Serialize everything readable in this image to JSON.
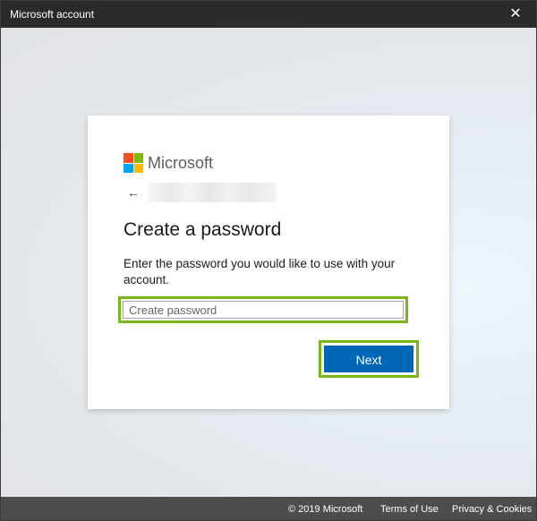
{
  "window": {
    "title": "Microsoft account",
    "close_glyph": "✕"
  },
  "signin": {
    "logo_text": "Microsoft",
    "logo_colors": [
      "#f25022",
      "#7fba00",
      "#00a4ef",
      "#ffb900"
    ],
    "back_glyph": "←",
    "heading": "Create a password",
    "description": "Enter the password you would like to use with your account.",
    "password_placeholder": "Create password",
    "password_value": "",
    "next_label": "Next"
  },
  "footer": {
    "copyright": "© 2019 Microsoft",
    "terms": "Terms of Use",
    "privacy": "Privacy & Cookies"
  },
  "colors": {
    "accent": "#0067b8",
    "highlight": "#7cb518",
    "titlebar": "#2b2b2b",
    "footer": "#4d4d4d"
  },
  "icons": {
    "close": "close-icon",
    "back": "back-arrow-icon",
    "logo": "microsoft-logo-icon"
  }
}
